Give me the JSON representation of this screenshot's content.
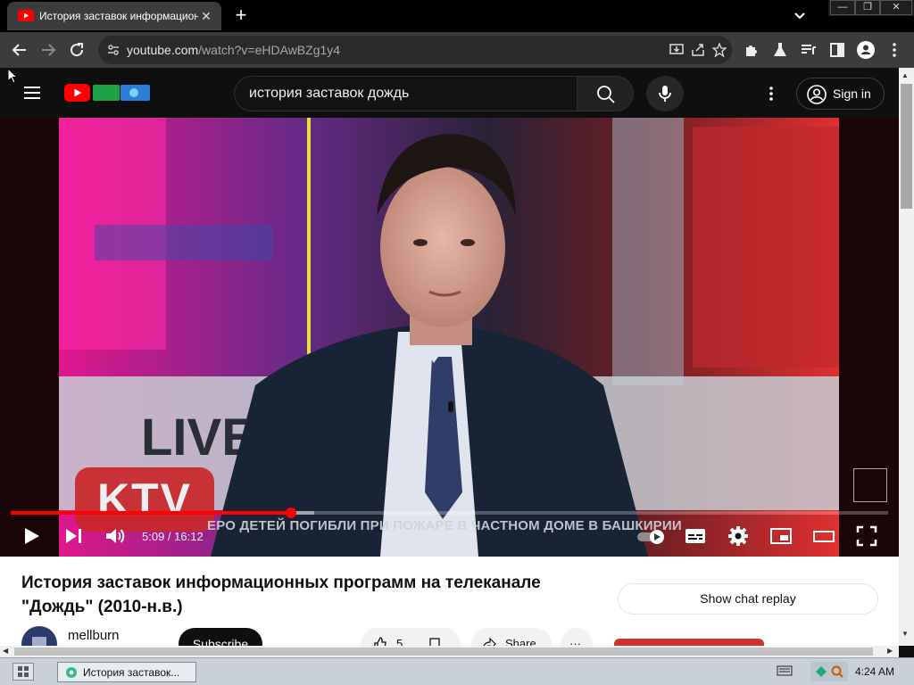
{
  "browser": {
    "tab_title": "История заставок информационных программ",
    "new_tab": "+",
    "tab_close": "✕",
    "url_host": "youtube.com",
    "url_path": "/watch?v=eHDAwBZg1y4",
    "window_min": "—",
    "window_restore": "❐",
    "window_close": "✕"
  },
  "youtube": {
    "search_query": "история заставок дождь",
    "sign_in": "Sign in",
    "accent": "#ff0000"
  },
  "player": {
    "timecode": "5:09 / 16:12",
    "progress_fraction": 0.319,
    "buffered_fraction": 0.346,
    "ticker": "ЕРО ДЕТЕЙ ПОГИБЛИ ПРИ ПОЖАРЕ В ЧАСТНОМ ДОМЕ В БАШКИРИИ",
    "logo_watermark": "KTV",
    "banner_word": "LIVE"
  },
  "video_info": {
    "title": "История заставок информационных программ на телеканале \"Дождь\" (2010-н.в.)",
    "show_chat": "Show chat replay",
    "channel": "mellburn",
    "subscribe": "Subscribe",
    "likes": "5",
    "share": "Share"
  },
  "taskbar": {
    "item": "История заставок...",
    "clock": "4:24 AM"
  }
}
